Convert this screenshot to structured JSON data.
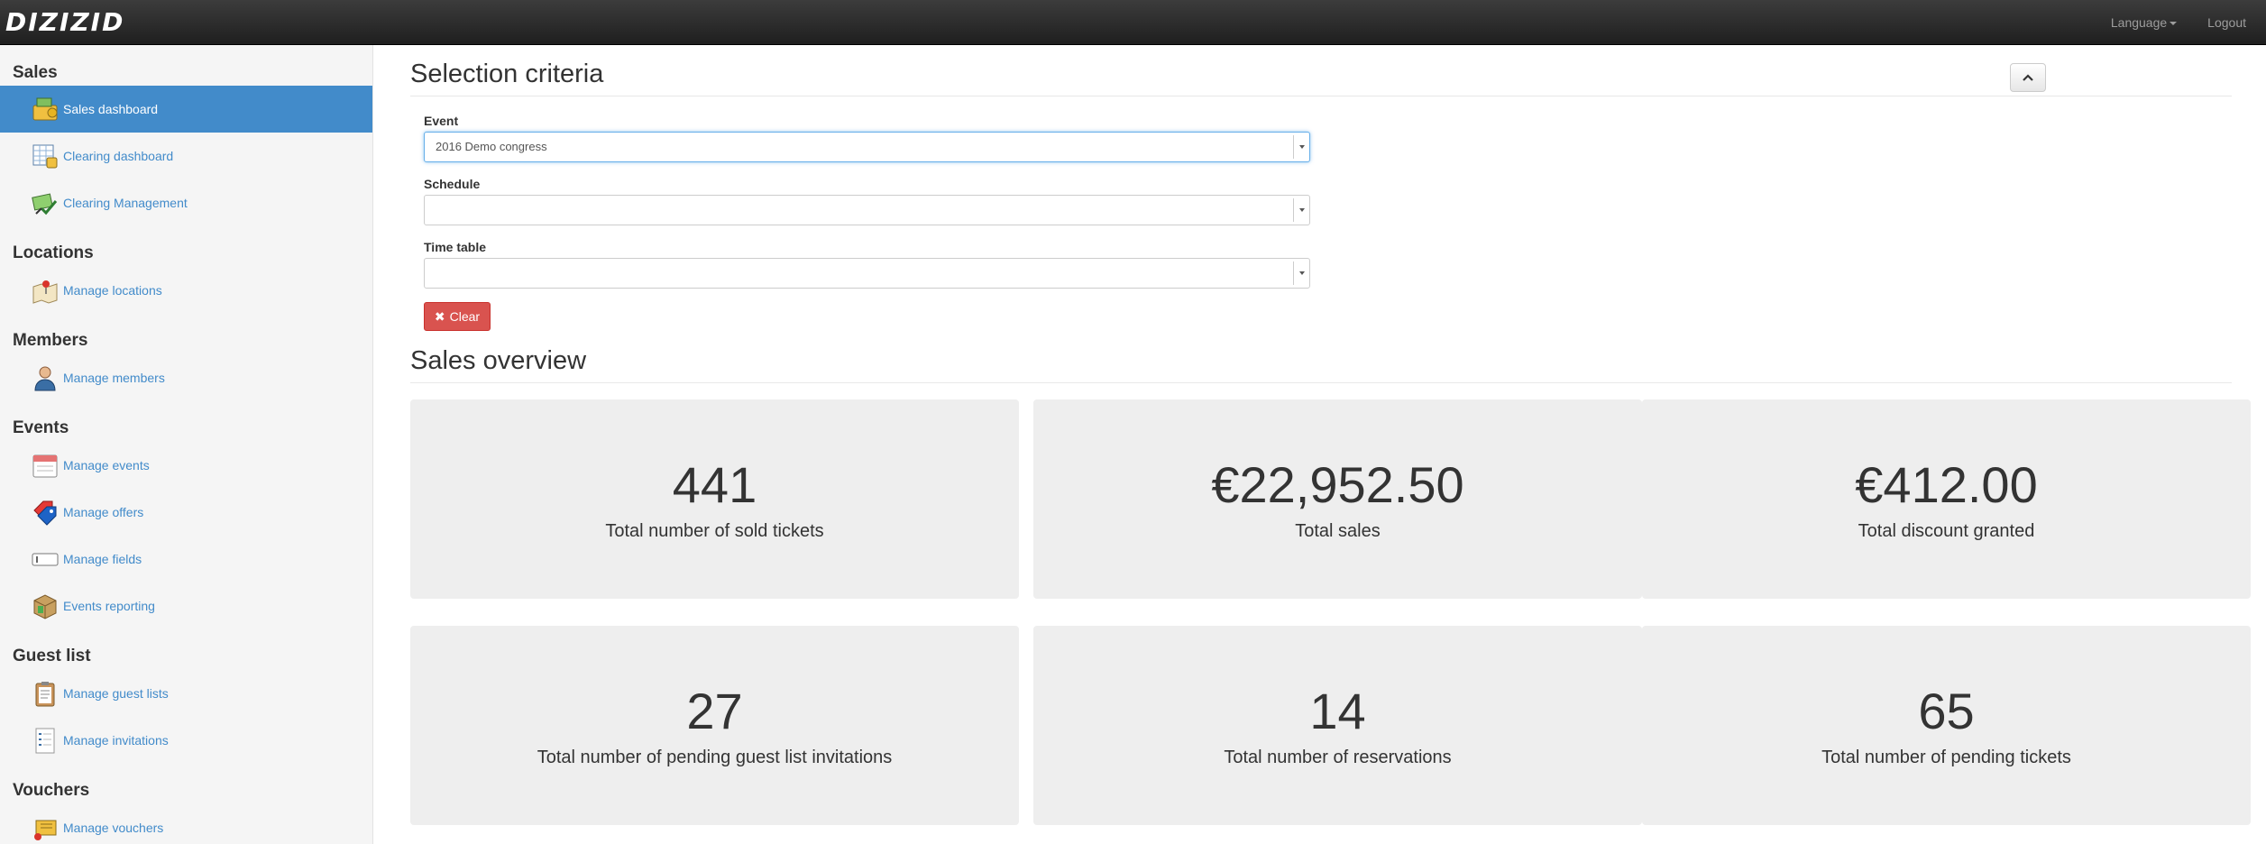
{
  "navbar": {
    "brand": "DIZIZID",
    "language_label": "Language",
    "logout_label": "Logout"
  },
  "sidebar": {
    "sections": [
      {
        "title": "Sales",
        "items": [
          {
            "label": "Sales dashboard",
            "icon": "cash-register-icon",
            "active": true
          },
          {
            "label": "Clearing dashboard",
            "icon": "calendar-grid-icon"
          },
          {
            "label": "Clearing Management",
            "icon": "money-check-icon"
          }
        ]
      },
      {
        "title": "Locations",
        "items": [
          {
            "label": "Manage locations",
            "icon": "map-pin-icon"
          }
        ]
      },
      {
        "title": "Members",
        "items": [
          {
            "label": "Manage members",
            "icon": "user-icon"
          }
        ]
      },
      {
        "title": "Events",
        "items": [
          {
            "label": "Manage events",
            "icon": "calendar-icon"
          },
          {
            "label": "Manage offers",
            "icon": "tags-icon"
          },
          {
            "label": "Manage fields",
            "icon": "text-field-icon"
          },
          {
            "label": "Events reporting",
            "icon": "report-box-icon"
          }
        ]
      },
      {
        "title": "Guest list",
        "items": [
          {
            "label": "Manage guest lists",
            "icon": "clipboard-icon"
          },
          {
            "label": "Manage invitations",
            "icon": "checklist-icon"
          }
        ]
      },
      {
        "title": "Vouchers",
        "items": [
          {
            "label": "Manage vouchers",
            "icon": "voucher-icon"
          }
        ]
      }
    ]
  },
  "selection": {
    "title": "Selection criteria",
    "event_label": "Event",
    "event_value": "2016 Demo congress",
    "schedule_label": "Schedule",
    "schedule_value": "",
    "timetable_label": "Time table",
    "timetable_value": "",
    "clear_label": "Clear"
  },
  "overview": {
    "title": "Sales overview",
    "stats": [
      {
        "value": "441",
        "caption": "Total number of sold tickets"
      },
      {
        "value": "€22,952.50",
        "caption": "Total sales"
      },
      {
        "value": "€412.00",
        "caption": "Total discount granted"
      },
      {
        "value": "27",
        "caption": "Total number of pending guest list invitations"
      },
      {
        "value": "14",
        "caption": "Total number of reservations"
      },
      {
        "value": "65",
        "caption": "Total number of pending tickets"
      }
    ]
  },
  "colors": {
    "accent": "#428bca",
    "danger": "#d9534f",
    "navbar": "#222222"
  }
}
